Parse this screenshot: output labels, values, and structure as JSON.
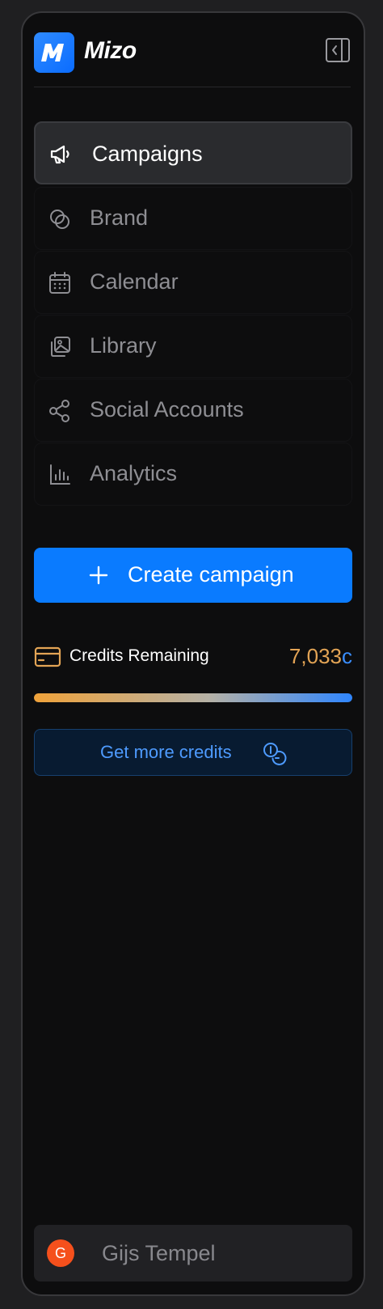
{
  "app": {
    "name": "Mizo"
  },
  "nav": {
    "items": [
      {
        "label": "Campaigns",
        "icon": "megaphone-icon",
        "active": true
      },
      {
        "label": "Brand",
        "icon": "brand-circles-icon",
        "active": false
      },
      {
        "label": "Calendar",
        "icon": "calendar-icon",
        "active": false
      },
      {
        "label": "Library",
        "icon": "image-library-icon",
        "active": false
      },
      {
        "label": "Social Accounts",
        "icon": "share-nodes-icon",
        "active": false
      },
      {
        "label": "Analytics",
        "icon": "bar-chart-icon",
        "active": false
      }
    ]
  },
  "create": {
    "label": "Create campaign"
  },
  "credits": {
    "label": "Credits Remaining",
    "value": "7,033",
    "unit": "c",
    "fill_fraction": 1.0
  },
  "more_credits": {
    "label": "Get more credits"
  },
  "user": {
    "initial": "G",
    "name": "Gijs Tempel"
  },
  "colors": {
    "accent": "#0a7bff",
    "credits_orange": "#e3a455",
    "avatar": "#f5501c"
  }
}
